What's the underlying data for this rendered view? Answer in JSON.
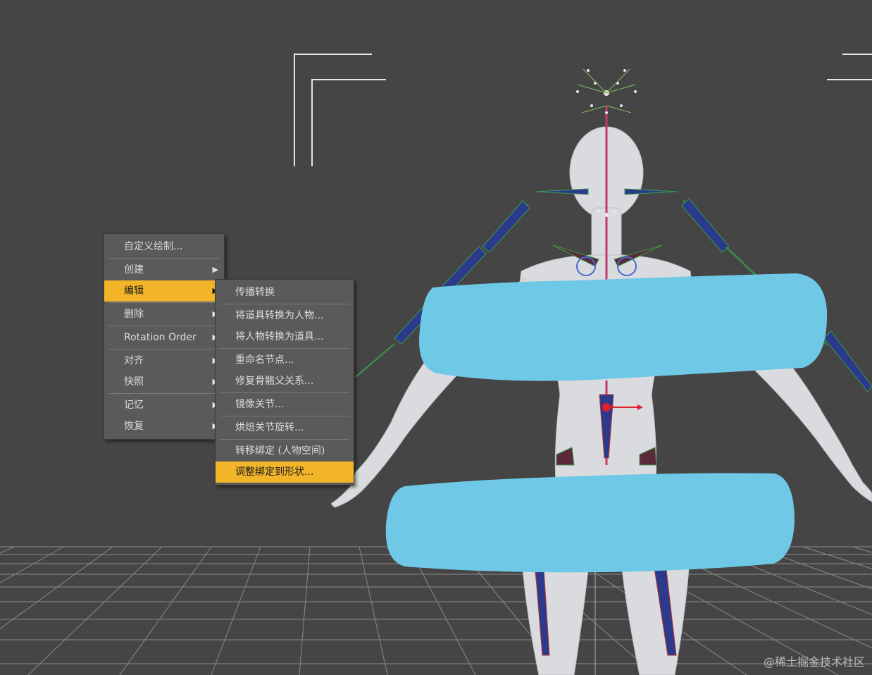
{
  "context_menu": {
    "items": [
      {
        "label": "自定义绘制...",
        "submenu": false
      },
      {
        "label": "创建",
        "submenu": true
      },
      {
        "label": "编辑",
        "submenu": true,
        "highlighted": true
      },
      {
        "label": "删除",
        "submenu": true
      },
      {
        "label": "Rotation Order",
        "submenu": true
      },
      {
        "label": "对齐",
        "submenu": true
      },
      {
        "label": "快照",
        "submenu": true
      },
      {
        "label": "记忆",
        "submenu": true
      },
      {
        "label": "恢复",
        "submenu": true
      }
    ],
    "arrow_glyph": "▶"
  },
  "edit_submenu": {
    "items": [
      {
        "label": "传播转换"
      },
      {
        "label": "将道具转换为人物..."
      },
      {
        "label": "将人物转换为道具..."
      },
      {
        "label": "重命名节点..."
      },
      {
        "label": "修复骨骼父关系..."
      },
      {
        "label": "镜像关节..."
      },
      {
        "label": "烘焙关节旋转..."
      },
      {
        "label": "转移绑定 (人物空间)"
      },
      {
        "label": "调整绑定到形状...",
        "highlighted": true
      }
    ]
  },
  "watermark": "@稀土掘金技术社区",
  "colors": {
    "viewport_bg": "#454545",
    "menu_bg": "#5a5a5a",
    "highlight": "#f2b52a",
    "censor": "#6ec8e6",
    "figure": "#d9dbde",
    "grid": "#8a8a8a"
  }
}
